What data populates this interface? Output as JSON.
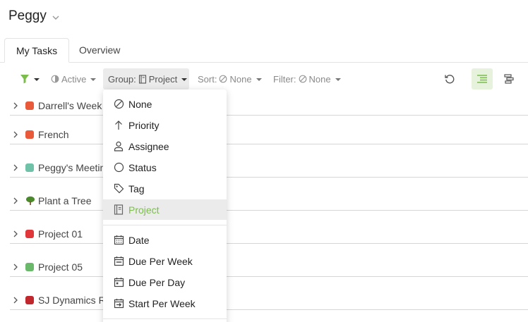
{
  "header": {
    "title": "Peggy"
  },
  "tabs": [
    {
      "label": "My Tasks",
      "active": true
    },
    {
      "label": "Overview",
      "active": false
    }
  ],
  "toolbar": {
    "active_label": "Active",
    "group_prefix": "Group:",
    "group_value": "Project",
    "sort_prefix": "Sort:",
    "sort_value": "None",
    "filter_prefix": "Filter:",
    "filter_value": "None"
  },
  "rows": [
    {
      "name": "Darrell's Week",
      "color": "#e85a3a",
      "icon": "color-square"
    },
    {
      "name": "French",
      "color": "#e85a3a",
      "icon": "color-square"
    },
    {
      "name": "Peggy's Meetin",
      "color": "#6fc1a8",
      "icon": "color-square"
    },
    {
      "name": "Plant a Tree",
      "color": "#4a8a2a",
      "icon": "tree-icon"
    },
    {
      "name": "Project 01",
      "color": "#e0373a",
      "icon": "color-square"
    },
    {
      "name": "Project 05",
      "color": "#6ab86a",
      "icon": "color-square"
    },
    {
      "name": "SJ Dynamics R",
      "color": "#c0282e",
      "icon": "color-square"
    }
  ],
  "group_menu": {
    "items": [
      {
        "label": "None",
        "icon": "none-icon"
      },
      {
        "label": "Priority",
        "icon": "arrow-up-icon"
      },
      {
        "label": "Assignee",
        "icon": "person-icon"
      },
      {
        "label": "Status",
        "icon": "circle-icon"
      },
      {
        "label": "Tag",
        "icon": "tag-icon"
      },
      {
        "label": "Project",
        "icon": "notebook-icon",
        "selected": true
      },
      {
        "label": "Date",
        "icon": "calendar-icon"
      },
      {
        "label": "Due Per Week",
        "icon": "calendar-week-icon"
      },
      {
        "label": "Due Per Day",
        "icon": "calendar-day-icon"
      },
      {
        "label": "Start Per Week",
        "icon": "calendar-start-icon"
      }
    ]
  },
  "colors": {
    "accent": "#7cbc4c",
    "selected_bg": "#ebebeb",
    "toggle_bg": "#e6f2dc"
  }
}
